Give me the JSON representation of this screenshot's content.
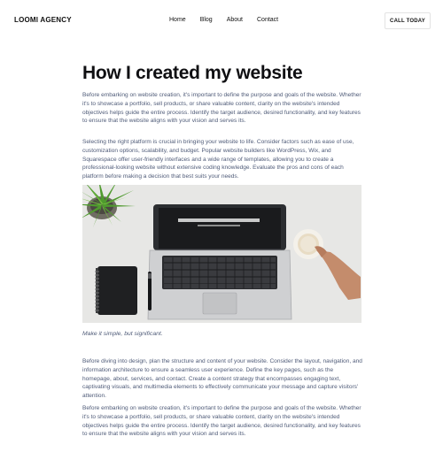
{
  "header": {
    "logo": "LOOMI AGENCY",
    "nav": [
      "Home",
      "Blog",
      "About",
      "Contact"
    ],
    "cta": "CALL TODAY"
  },
  "article": {
    "title": "How I created my website",
    "paragraphs": [
      "Before embarking on website creation, it's important to define the purpose and goals of the website. Whether it's to showcase a portfolio, sell products, or share valuable content, clarity on the website's intended objectives helps guide the entire process. Identify the target audience, desired functionality, and key features to ensure that the website aligns with your vision and serves its.",
      "Selecting the right platform is crucial in bringing your website to life. Consider factors such as ease of use, customization options, scalability, and budget. Popular website builders like WordPress, Wix, and Squarespace offer user-friendly interfaces and a wide range of templates, allowing you to create a professional-looking website without extensive coding knowledge. Evaluate the pros and cons of each platform before making a decision that best suits your needs.",
      "Before diving into design, plan the structure and content of your website. Consider the layout, navigation, and information architecture to ensure a seamless user experience. Define the key pages, such as the homepage, about, services, and contact. Create a content strategy that encompasses engaging text, captivating visuals, and multimedia elements to effectively communicate your message and capture visitors' attention.",
      "Before embarking on website creation, it's important to define the purpose and goals of the website. Whether it's to showcase a portfolio, sell products, or share valuable content, clarity on the website's intended objectives helps guide the entire process. Identify the target audience, desired functionality, and key features to ensure that the website aligns with your vision and serves its."
    ],
    "caption": "Make it simple, but significant."
  },
  "colors": {
    "body_text": "#4f5b78",
    "heading": "#0f0f12",
    "photo_background": "#e6e6e4"
  }
}
